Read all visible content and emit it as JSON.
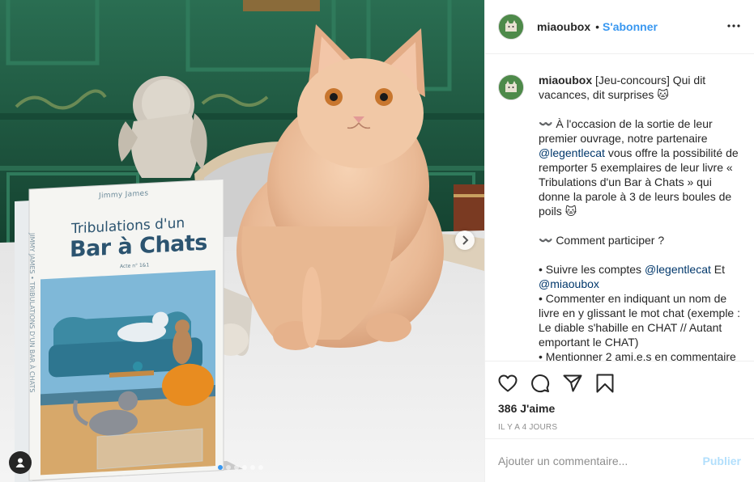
{
  "header": {
    "username": "miaoubox",
    "separator": "•",
    "follow_label": "S'abonner",
    "more_icon": "more-horizontal-icon"
  },
  "book_cover": {
    "author": "Jimmy James",
    "title_line1": "Tribulations d'un",
    "title_line2": "Bar à Chats",
    "subtitle": "Acte n° 1&1",
    "spine": "JIMMY JAMES • TRIBULATIONS D'UN BAR À CHATS"
  },
  "caption": {
    "username": "miaoubox",
    "intro": "[Jeu-concours] Qui dit vacances, dit surprises 🐱",
    "para1_before": "〰️ À l'occasion de la sortie de leur premier ouvrage, notre partenaire ",
    "para1_mention": "@legentlecat",
    "para1_after": " vous offre la possibilité de remporter 5 exemplaires de leur livre « Tribulations d'un Bar à Chats » qui donne la parole à 3 de leurs boules de poils 🐱",
    "para2": "〰️ Comment participer ?",
    "bullet1_before": "• Suivre les comptes ",
    "bullet1_mention1": "@legentlecat",
    "bullet1_mid": " Et ",
    "bullet1_mention2": "@miaoubox",
    "bullet2": "• Commenter en indiquant un nom de livre en y glissant le mot chat (exemple : Le diable s'habille en CHAT // Autant emportant le CHAT)",
    "bullet3": "• Mentionner 2 ami.e.s en commentaire"
  },
  "actions": {
    "likes": "386 J'aime",
    "time": "IL Y A 4 JOURS"
  },
  "add_comment": {
    "placeholder": "Ajouter un commentaire...",
    "publish_label": "Publier"
  },
  "carousel": {
    "total": 6,
    "active": 1
  },
  "colors": {
    "accent": "#3897f0",
    "publish_disabled": "#b2dffc",
    "text": "#262626",
    "muted": "#8e8e8e",
    "wall_green": "#1f5c43"
  }
}
